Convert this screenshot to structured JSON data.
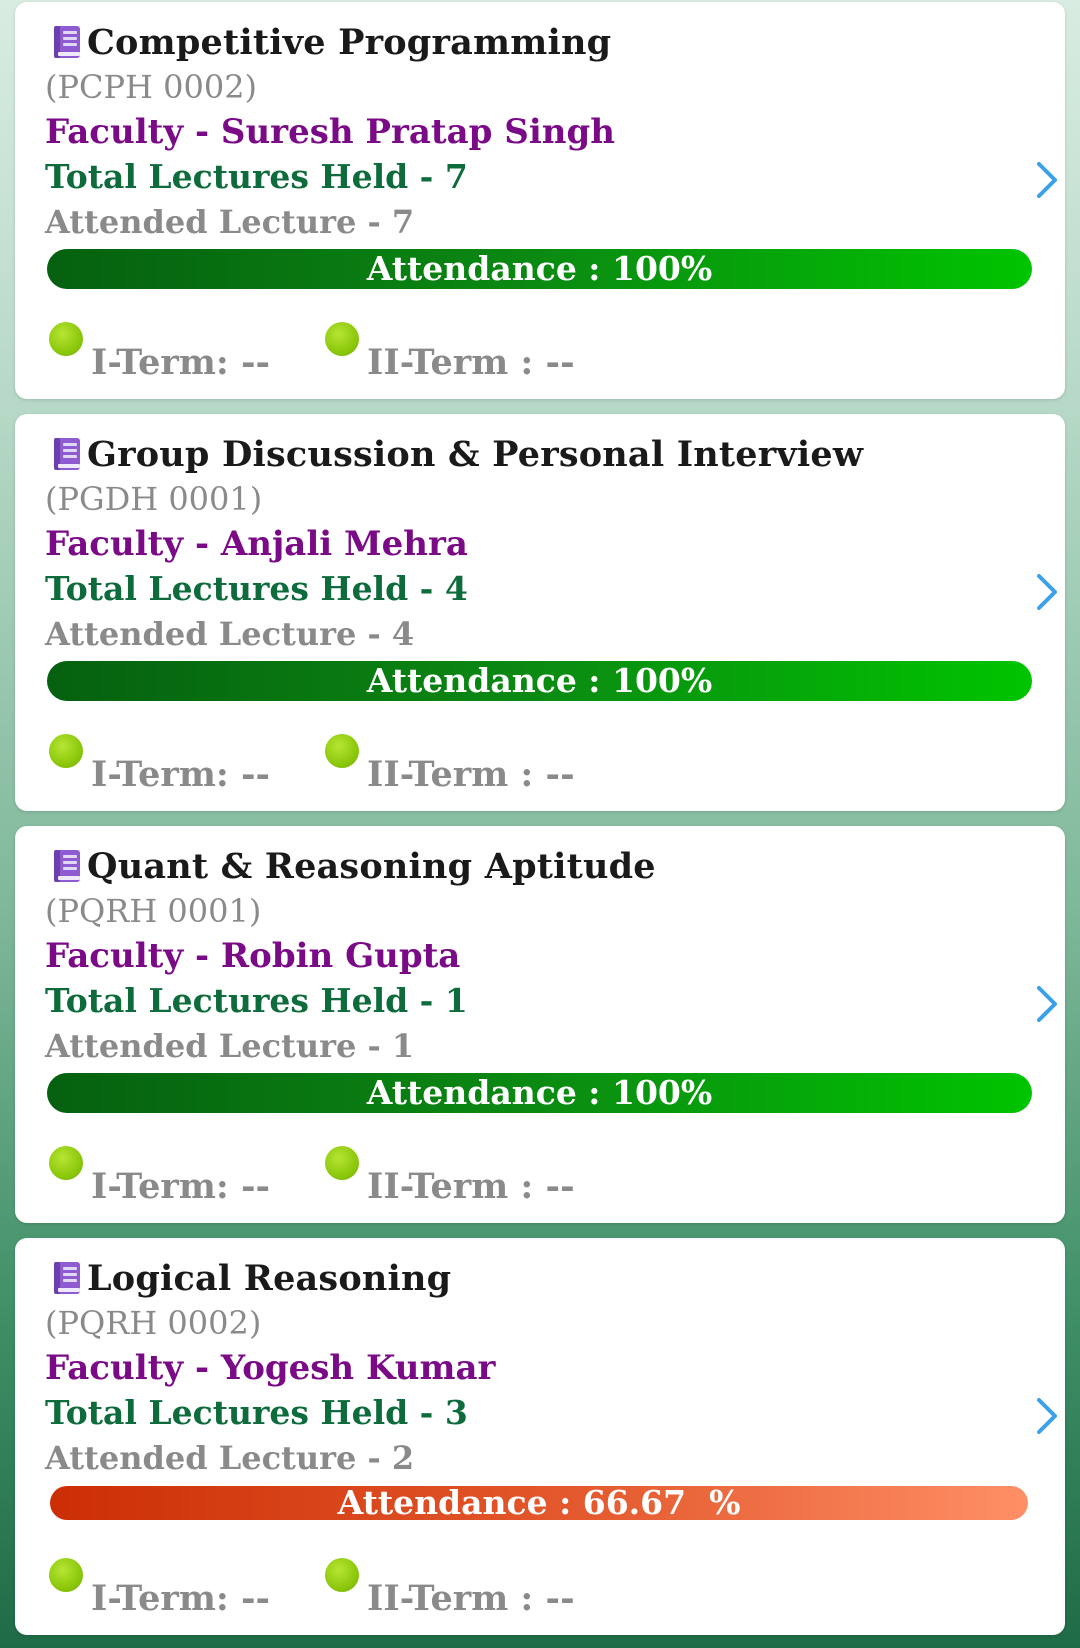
{
  "courses": [
    {
      "title": "Competitive Programming",
      "code": "(PCPH 0002)",
      "faculty": "Faculty  - Suresh Pratap Singh",
      "lectures_held": "Total Lectures Held - 7",
      "attended": "Attended Lecture - 7",
      "attendance_label": "Attendance : 100%",
      "attendance_percent": 100,
      "bar_color": "#0b8a12",
      "term1": "I-Term: --",
      "term2": "II-Term : --"
    },
    {
      "title": "Group Discussion & Personal Interview",
      "code": "(PGDH 0001)",
      "faculty": "Faculty  - Anjali Mehra",
      "lectures_held": "Total Lectures Held - 4",
      "attended": "Attended Lecture - 4",
      "attendance_label": "Attendance : 100%",
      "attendance_percent": 100,
      "bar_color": "#0b8a12",
      "term1": "I-Term: --",
      "term2": "II-Term : --"
    },
    {
      "title": "Quant & Reasoning Aptitude",
      "code": "(PQRH 0001)",
      "faculty": "Faculty  - Robin Gupta",
      "lectures_held": "Total Lectures Held - 1",
      "attended": "Attended Lecture - 1",
      "attendance_label": "Attendance : 100%",
      "attendance_percent": 100,
      "bar_color": "#0b8a12",
      "term1": "I-Term: --",
      "term2": "II-Term : --"
    },
    {
      "title": "Logical Reasoning",
      "code": "(PQRH 0002)",
      "faculty": "Faculty  - Yogesh Kumar",
      "lectures_held": "Total Lectures Held - 3",
      "attended": "Attended Lecture - 2",
      "attendance_label": "Attendance : 66.67  %",
      "attendance_percent": 66.67,
      "bar_color": "#e45a2e",
      "term1": "I-Term: --",
      "term2": "II-Term : --"
    }
  ],
  "icons": {
    "course": "book-icon",
    "term": "status-dot-icon",
    "open": "chevron-right-icon"
  },
  "colors": {
    "faculty": "#7a0a86",
    "lectures": "#0d6b3c",
    "muted": "#8a8a8a",
    "chevron": "#3aa0e8",
    "term_dot": "#8cc80c"
  }
}
